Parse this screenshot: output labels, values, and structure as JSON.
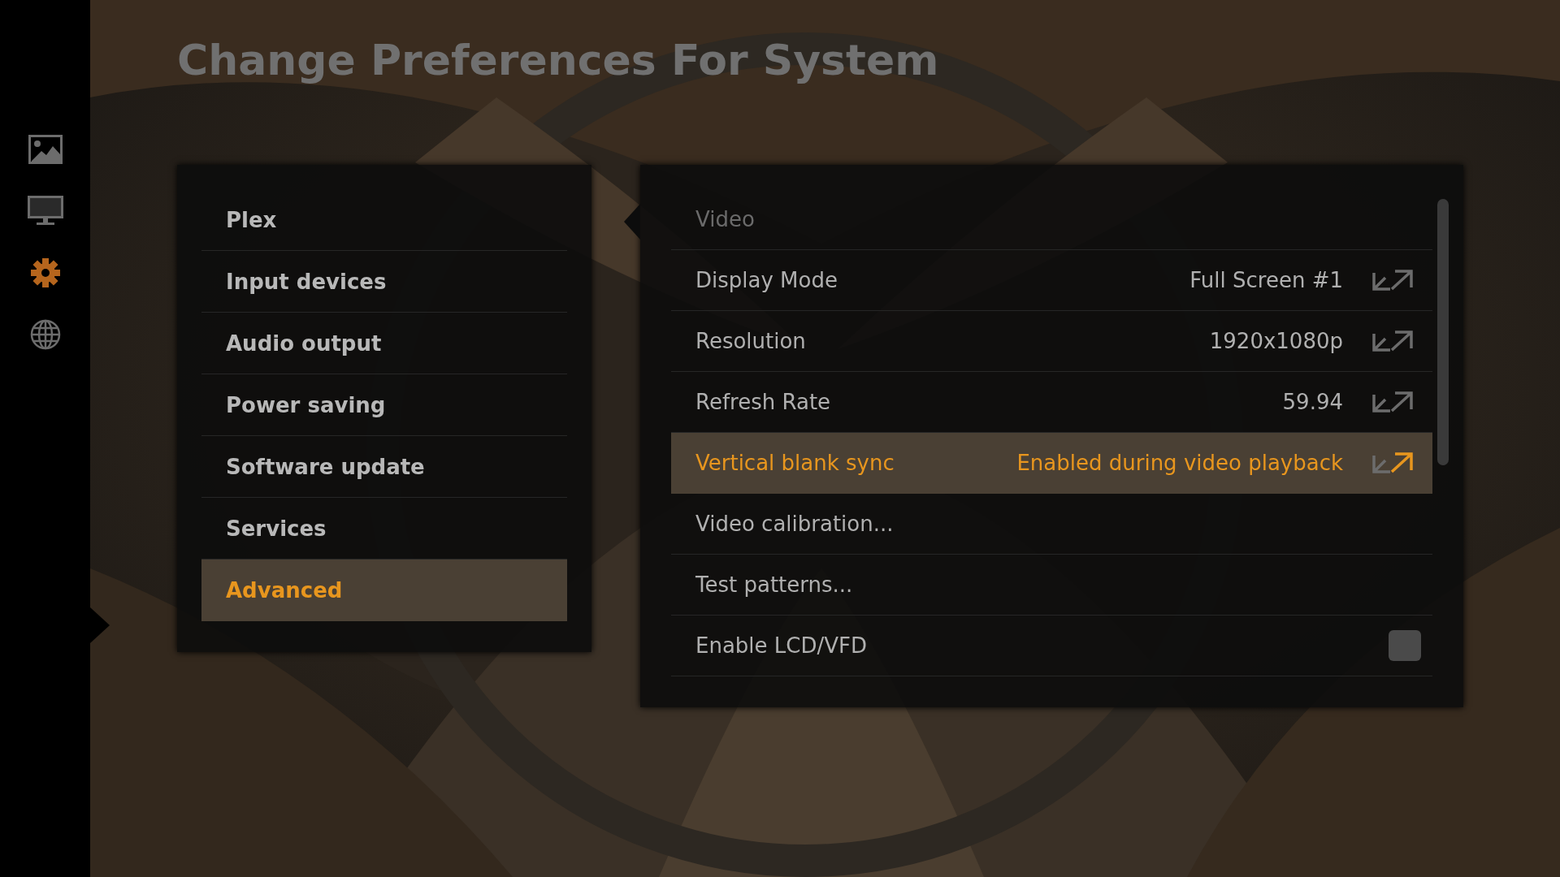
{
  "title": "Change Preferences For System",
  "sidebar": {
    "items": [
      {
        "selected": false
      },
      {
        "selected": false
      },
      {
        "selected": true
      },
      {
        "selected": false
      }
    ]
  },
  "categories": [
    {
      "label": "Plex",
      "selected": false
    },
    {
      "label": "Input devices",
      "selected": false
    },
    {
      "label": "Audio output",
      "selected": false
    },
    {
      "label": "Power saving",
      "selected": false
    },
    {
      "label": "Software update",
      "selected": false
    },
    {
      "label": "Services",
      "selected": false
    },
    {
      "label": "Advanced",
      "selected": true
    }
  ],
  "settings": [
    {
      "kind": "header",
      "label": "Video"
    },
    {
      "kind": "option",
      "label": "Display Mode",
      "value": "Full Screen #1",
      "selected": false
    },
    {
      "kind": "option",
      "label": "Resolution",
      "value": "1920x1080p",
      "selected": false
    },
    {
      "kind": "option",
      "label": "Refresh Rate",
      "value": "59.94",
      "selected": false
    },
    {
      "kind": "option",
      "label": "Vertical blank sync",
      "value": "Enabled during video playback",
      "selected": true
    },
    {
      "kind": "action",
      "label": "Video calibration...",
      "selected": false
    },
    {
      "kind": "action",
      "label": "Test patterns...",
      "selected": false
    },
    {
      "kind": "checkbox",
      "label": "Enable LCD/VFD",
      "checked": false,
      "selected": false
    }
  ]
}
